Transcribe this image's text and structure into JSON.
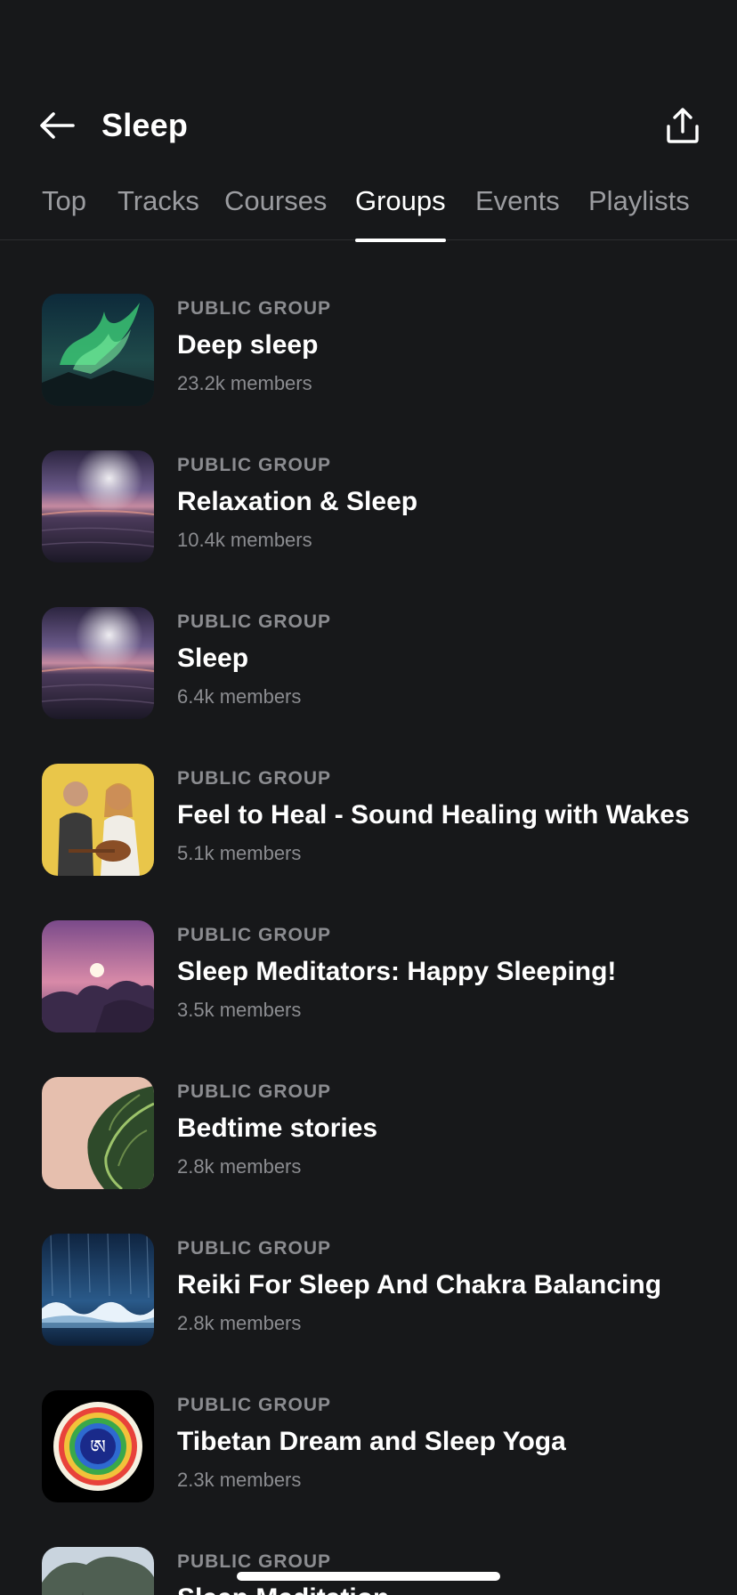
{
  "header": {
    "title": "Sleep"
  },
  "tabs": [
    {
      "label": "Top"
    },
    {
      "label": "Tracks"
    },
    {
      "label": "Courses"
    },
    {
      "label": "Groups"
    },
    {
      "label": "Events"
    },
    {
      "label": "Playlists"
    }
  ],
  "active_tab": "Groups",
  "groups": [
    {
      "kicker": "PUBLIC GROUP",
      "name": "Deep sleep",
      "members": "23.2k members",
      "thumb": "aurora-image"
    },
    {
      "kicker": "PUBLIC GROUP",
      "name": "Relaxation & Sleep",
      "members": "10.4k members",
      "thumb": "purple-sunset-sea-image"
    },
    {
      "kicker": "PUBLIC GROUP",
      "name": "Sleep",
      "members": "6.4k members",
      "thumb": "purple-sunset-sea-image"
    },
    {
      "kicker": "PUBLIC GROUP",
      "name": "Feel to Heal - Sound Healing with Wakes",
      "members": "5.1k members",
      "thumb": "musicians-photo"
    },
    {
      "kicker": "PUBLIC GROUP",
      "name": "Sleep Meditators: Happy Sleeping!",
      "members": "3.5k members",
      "thumb": "moon-clouds-image"
    },
    {
      "kicker": "PUBLIC GROUP",
      "name": "Bedtime stories",
      "members": "2.8k members",
      "thumb": "plant-leaf-image"
    },
    {
      "kicker": "PUBLIC GROUP",
      "name": "Reiki For Sleep And Chakra Balancing",
      "members": "2.8k members",
      "thumb": "wave-image"
    },
    {
      "kicker": "PUBLIC GROUP",
      "name": "Tibetan Dream and Sleep Yoga",
      "members": "2.3k members",
      "thumb": "tibetan-rainbow-logo"
    },
    {
      "kicker": "PUBLIC GROUP",
      "name": "Sleep Meditation",
      "members": "",
      "thumb": "tree-image"
    }
  ],
  "icons": {
    "back": "arrow-left-icon",
    "share": "share-upload-icon"
  },
  "colors": {
    "background": "#17181a",
    "text_primary": "#ffffff",
    "text_secondary": "#8b8c90",
    "tab_inactive": "#9b9ca0"
  }
}
